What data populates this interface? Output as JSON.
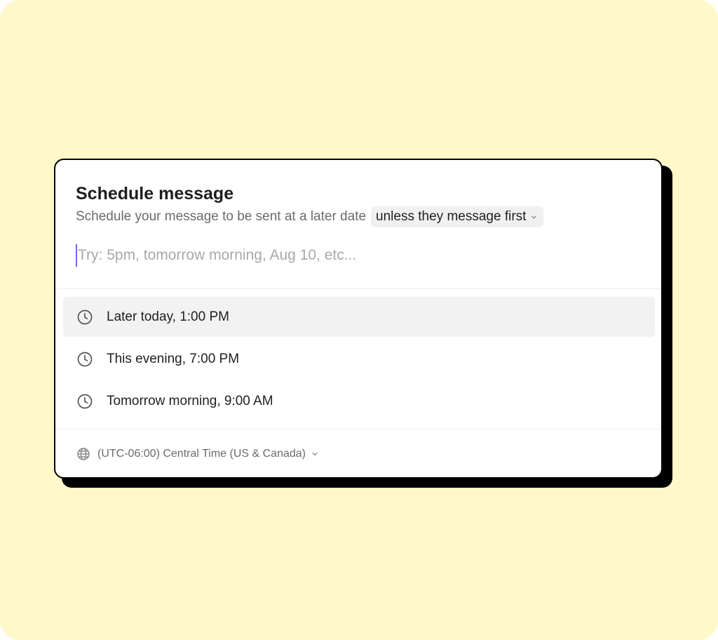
{
  "colors": {
    "background": "#fff8c9",
    "card": "#ffffff",
    "accent_caret": "#7b61ff",
    "highlight_row": "#f2f2f2"
  },
  "dialog": {
    "title": "Schedule message",
    "subtitle": "Schedule your message to be sent at a later date",
    "condition_dropdown": {
      "selected": "unless they message first",
      "icon": "chevron-down-icon"
    },
    "time_input": {
      "value": "",
      "placeholder": "Try: 5pm, tomorrow morning, Aug 10, etc..."
    },
    "options": [
      {
        "label": "Later today, 1:00 PM",
        "icon": "clock-icon",
        "highlighted": true
      },
      {
        "label": "This evening, 7:00 PM",
        "icon": "clock-icon",
        "highlighted": false
      },
      {
        "label": "Tomorrow morning, 9:00 AM",
        "icon": "clock-icon",
        "highlighted": false
      }
    ],
    "timezone": {
      "label": "(UTC-06:00) Central Time (US & Canada)",
      "icon": "globe-icon",
      "dropdown_icon": "chevron-down-icon"
    }
  }
}
